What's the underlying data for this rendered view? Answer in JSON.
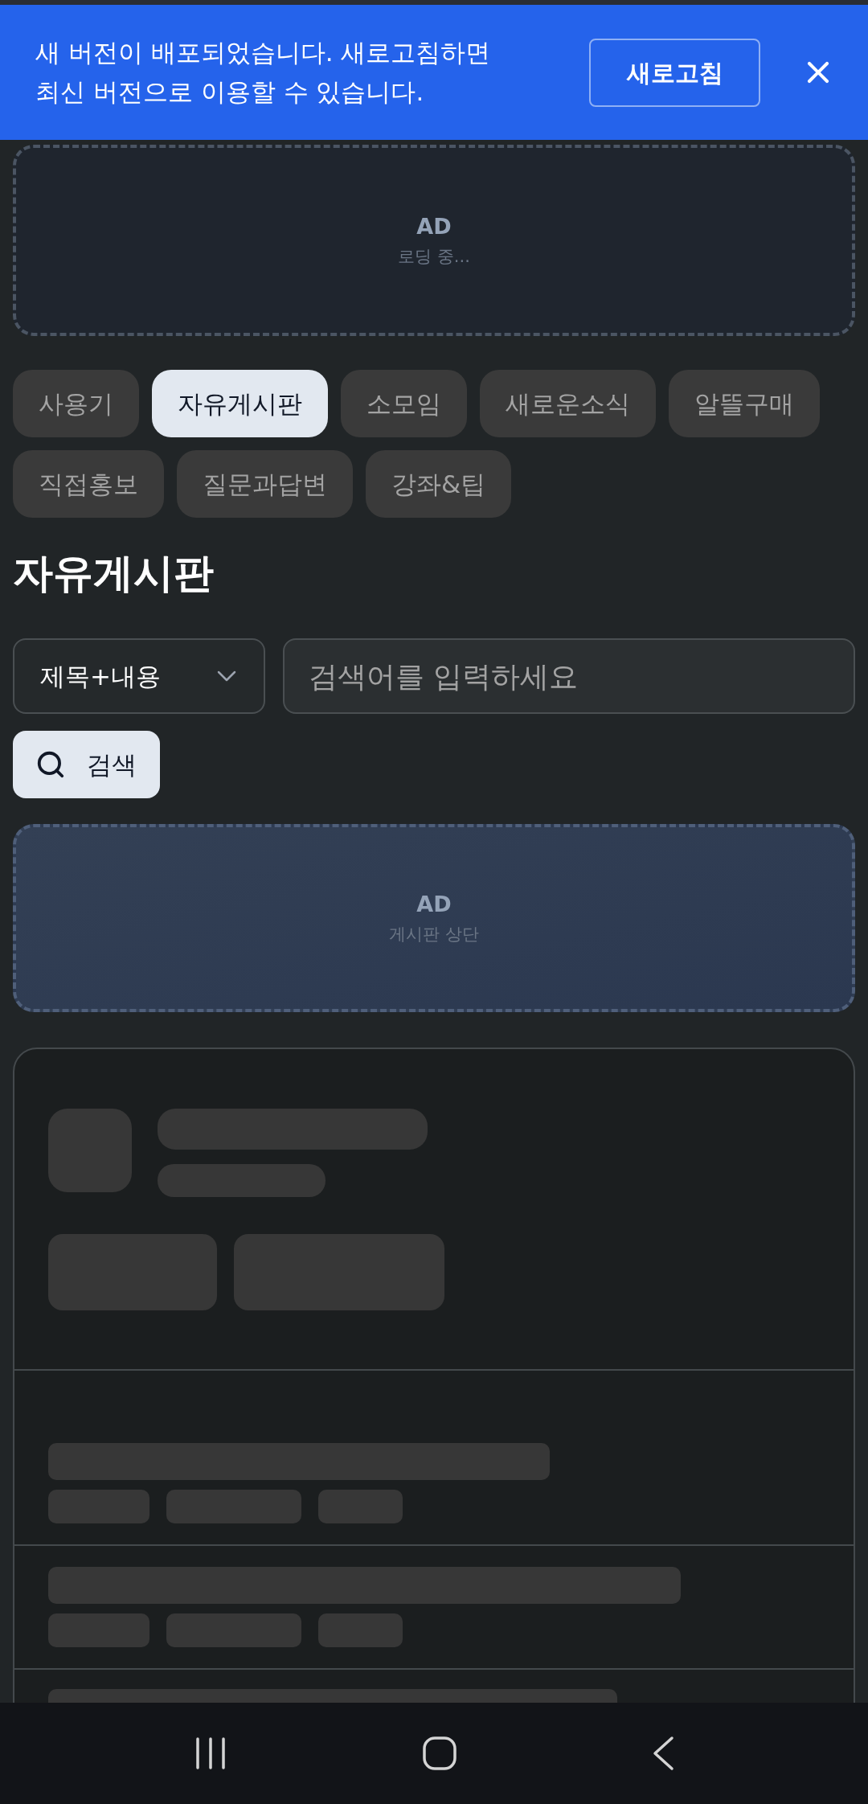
{
  "update_banner": {
    "message": "새 버전이 배포되었습니다. 새로고침하면 최신 버전으로 이용할 수 있습니다.",
    "button": "새로고침"
  },
  "ads": [
    {
      "kind": "loading",
      "label": "AD",
      "caption": "로딩 중..."
    },
    {
      "kind": "board_top",
      "label": "AD",
      "caption": "게시판 상단"
    }
  ],
  "categories": [
    {
      "label": "사용기",
      "selected": false
    },
    {
      "label": "자유게시판",
      "selected": true
    },
    {
      "label": "소모임",
      "selected": false
    },
    {
      "label": "새로운소식",
      "selected": false
    },
    {
      "label": "알뜰구매",
      "selected": false
    },
    {
      "label": "직접홍보",
      "selected": false
    },
    {
      "label": "질문과답변",
      "selected": false
    },
    {
      "label": "강좌&팁",
      "selected": false
    }
  ],
  "board_title": "자유게시판",
  "search": {
    "scope": "제목+내용",
    "placeholder": "검색어를 입력하세요",
    "button": "검색"
  }
}
